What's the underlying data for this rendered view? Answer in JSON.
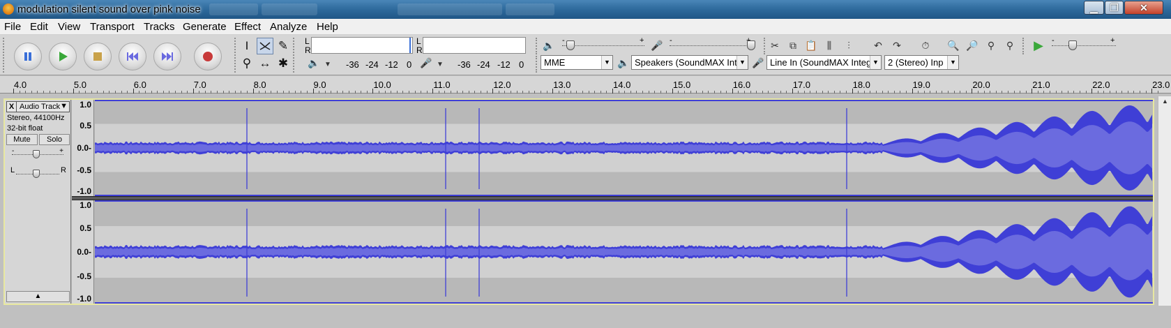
{
  "window": {
    "title": "modulation silent sound over pink noise"
  },
  "menu": [
    "File",
    "Edit",
    "View",
    "Transport",
    "Tracks",
    "Generate",
    "Effect",
    "Analyze",
    "Help"
  ],
  "transport": {
    "buttons": [
      "pause-icon",
      "play-icon",
      "stop-icon",
      "skip-start-icon",
      "skip-end-icon",
      "record-icon"
    ]
  },
  "meters": {
    "playback_scale": [
      "-36",
      "-24",
      "-12",
      "0"
    ],
    "record_scale": [
      "-36",
      "-24",
      "-12",
      "0"
    ],
    "l_label": "L",
    "r_label": "R"
  },
  "slider_marks": {
    "minus": "-",
    "plus": "+"
  },
  "device": {
    "host": "MME",
    "output": "Speakers (SoundMAX Int",
    "input": "Line In (SoundMAX Integ",
    "channels": "2 (Stereo) Inp"
  },
  "ruler": {
    "ticks": [
      "4.0",
      "5.0",
      "6.0",
      "7.0",
      "8.0",
      "9.0",
      "10.0",
      "11.0",
      "12.0",
      "13.0",
      "14.0",
      "15.0",
      "16.0",
      "17.0",
      "18.0",
      "19.0",
      "20.0",
      "21.0",
      "22.0",
      "23.0"
    ]
  },
  "track": {
    "close_label": "X",
    "name": "Audio Track",
    "menu_arrow": "▼",
    "info_rate": "Stereo, 44100Hz",
    "info_format": "32-bit float",
    "mute": "Mute",
    "solo": "Solo",
    "gain_minus": "-",
    "gain_plus": "+",
    "pan_left": "L",
    "pan_right": "R",
    "collapse": "▲"
  },
  "vscale_labels": [
    "1.0",
    "0.5",
    "0.0-",
    "-0.5",
    "-1.0"
  ],
  "colors": {
    "waveform": "#3f3fd6",
    "waveform_rms": "#6b6bdf",
    "track_bg": "#b8b8b8",
    "track_band": "#d0d0d0"
  }
}
